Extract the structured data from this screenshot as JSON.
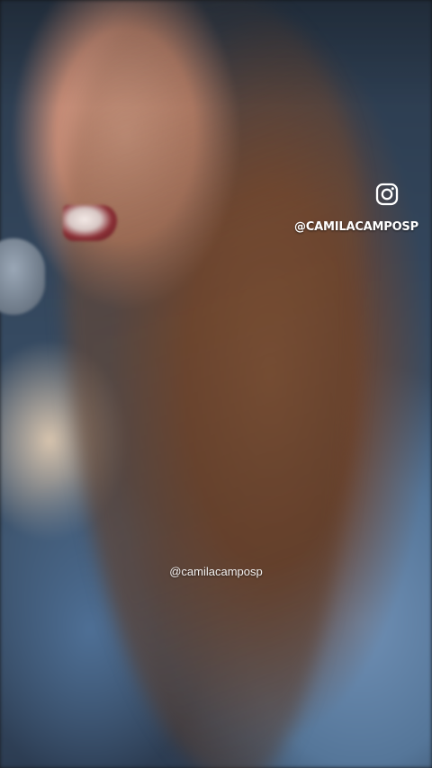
{
  "overlay": {
    "instagram_icon": "instagram-icon",
    "instagram_handle": "@CAMILACAMPOSP"
  },
  "watermark": {
    "handle": "@camilacamposp"
  },
  "colors": {
    "text": "#ffffff"
  }
}
